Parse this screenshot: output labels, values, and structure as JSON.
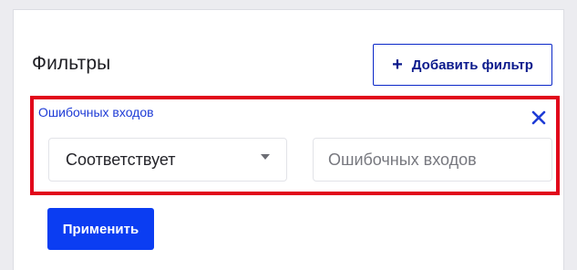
{
  "filters_panel": {
    "title": "Фильтры",
    "add_filter_button": {
      "label": "Добавить фильтр",
      "icon": "plus-icon"
    },
    "active_filter": {
      "field_label": "Ошибочных входов",
      "remove_icon": "close-icon",
      "condition_select": {
        "selected_value": "Соответствует",
        "icon": "chevron-down-icon"
      },
      "value_input": {
        "value": "",
        "placeholder": "Ошибочных входов"
      }
    },
    "apply_button": {
      "label": "Применить"
    }
  },
  "colors": {
    "highlight_border": "#e1061b",
    "primary_blue": "#0b3df2",
    "outline_blue": "#0b28c8",
    "link_blue": "#1f3cd6"
  }
}
